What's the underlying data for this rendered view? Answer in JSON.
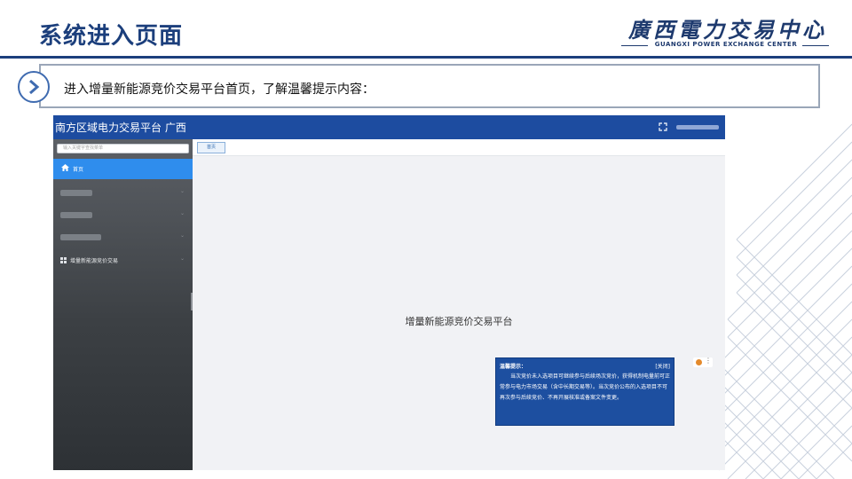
{
  "slide": {
    "title": "系统进入页面",
    "logo_cn": "廣西電力交易中心",
    "logo_en": "GUANGXI POWER EXCHANGE CENTER",
    "instruction": "进入增量新能源竞价交易平台首页，了解温馨提示内容："
  },
  "app": {
    "title": "南方区域电力交易平台 广西",
    "search_placeholder": "输入关键字查找菜单",
    "sidebar": {
      "home_label": "首页",
      "items": [
        {
          "label": "",
          "blurred": true
        },
        {
          "label": "",
          "blurred": true
        },
        {
          "label": "",
          "blurred": true
        },
        {
          "label": "增量新能源竞价交易",
          "blurred": false
        }
      ]
    },
    "tabs": [
      {
        "label": "首页",
        "active": true
      }
    ],
    "main_title": "增量新能源竞价交易平台",
    "tip": {
      "title": "温馨提示：",
      "close_label": "[关闭]",
      "body": "当次竞价未入选项目可继续参与后续场次竞价，获得机制电量前可正常参与电力市场交易（含中长期交易等）。当次竞价公布的入选项目不可再次参与后续竞价、不再开展核准或备案文件变更。"
    }
  },
  "colors": {
    "brand_blue": "#1d4ca0",
    "sidebar_active": "#2f8ded",
    "slide_title": "#1c3f7c"
  }
}
